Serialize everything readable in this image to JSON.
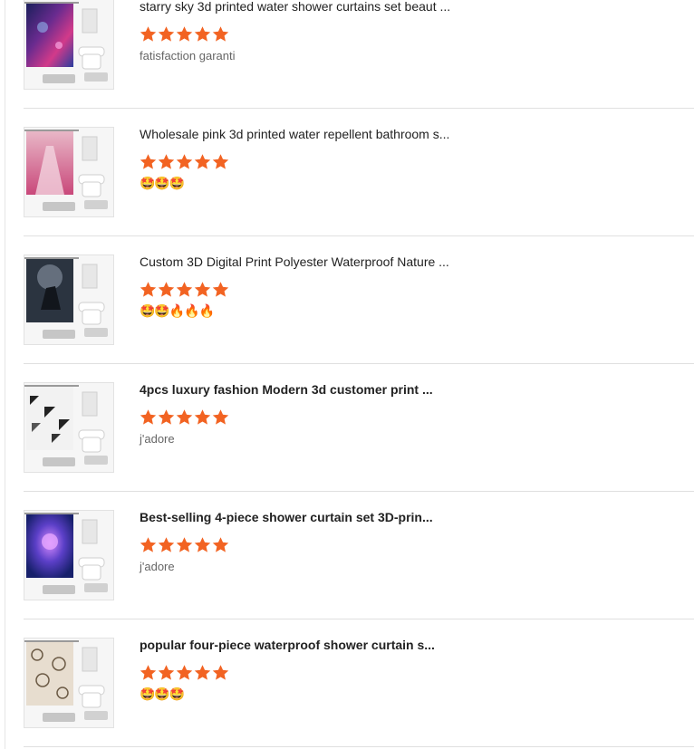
{
  "theme": {
    "star_color": "#f26322",
    "divider_color": "#e0e0e0"
  },
  "reviews": [
    {
      "title": "starry sky 3d printed water shower curtains set beaut ...",
      "rating": 5,
      "comment": "fatisfaction garanti",
      "curtain": "galaxy"
    },
    {
      "title": "Wholesale pink 3d printed water repellent bathroom s...",
      "rating": 5,
      "comment": "🤩🤩🤩",
      "curtain": "pink-path"
    },
    {
      "title": "Custom 3D Digital Print Polyester Waterproof Nature ...",
      "rating": 5,
      "comment": "🤩🤩🔥🔥🔥",
      "curtain": "dark-horse"
    },
    {
      "title": "4pcs luxury fashion Modern 3d customer print ...",
      "rating": 5,
      "comment": "j'adore",
      "curtain": "geometric"
    },
    {
      "title": "Best-selling 4-piece shower curtain set 3D-prin...",
      "rating": 5,
      "comment": "j'adore",
      "curtain": "purple-flower"
    },
    {
      "title": "popular four-piece waterproof shower curtain s...",
      "rating": 5,
      "comment": "🤩🤩🤩",
      "curtain": "paisley"
    }
  ]
}
